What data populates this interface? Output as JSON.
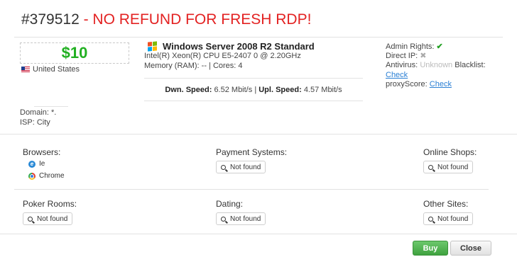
{
  "header": {
    "order_id": "#379512",
    "notice": "- NO REFUND FOR FRESH RDP!"
  },
  "price": "$10",
  "location": {
    "flag": "us-flag-icon",
    "country": "United States"
  },
  "host": {
    "domain": "Domain: *.",
    "isp": "ISP: City"
  },
  "system": {
    "os_icon": "windows-icon",
    "os": "Windows Server 2008 R2 Standard",
    "cpu": "Intel(R) Xeon(R) CPU E5-2407 0 @ 2.20GHz",
    "memory": "Memory (RAM): -- | Cores: 4"
  },
  "speed": {
    "down_label": "Dwn. Speed:",
    "down_value": "6.52 Mbit/s",
    "separator": "|",
    "up_label": "Upl. Speed:",
    "up_value": "4.57 Mbit/s"
  },
  "rights": {
    "admin_label": "Admin Rights:",
    "admin_icon": "check-icon",
    "direct_ip_label": "Direct IP:",
    "direct_ip_icon": "x-icon",
    "antivirus_label": "Antivirus:",
    "antivirus_value": "Unknown",
    "blacklist_label": "Blacklist:",
    "blacklist_link": "Check",
    "proxy_label": "proxyScore:",
    "proxy_link": "Check"
  },
  "sections": {
    "browsers": {
      "label": "Browsers:",
      "items": [
        "Ie",
        "Chrome"
      ]
    },
    "payment": {
      "label": "Payment Systems:",
      "button": "Not found"
    },
    "shops": {
      "label": "Online Shops:",
      "button": "Not found"
    },
    "poker": {
      "label": "Poker Rooms:",
      "button": "Not found"
    },
    "dating": {
      "label": "Dating:",
      "button": "Not found"
    },
    "other": {
      "label": "Other Sites:",
      "button": "Not found"
    }
  },
  "footer": {
    "buy": "Buy",
    "close": "Close"
  },
  "colors": {
    "notice": "#e32222",
    "price": "#22b022",
    "link": "#2a7fd4",
    "buy": "#4cae4c"
  }
}
